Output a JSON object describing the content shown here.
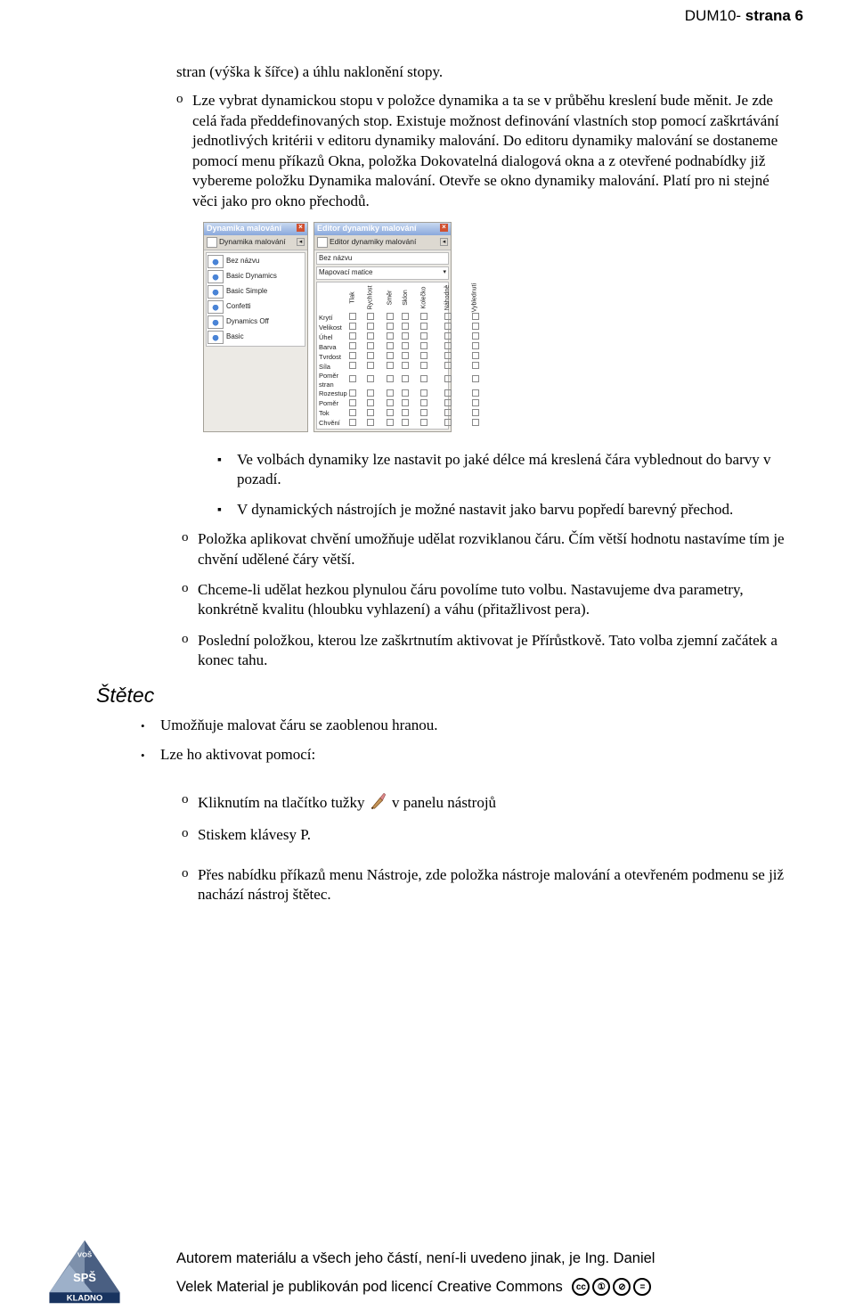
{
  "header": {
    "prefix": "DUM10- ",
    "bold": "strana 6"
  },
  "text": {
    "p0": "stran (výška k šířce) a úhlu naklonění stopy.",
    "o_marker": "o",
    "o1": "Lze vybrat dynamickou stopu v položce dynamika a ta se v průběhu kreslení bude měnit. Je zde celá řada předdefinovaných stop. Existuje možnost definování vlastních stop pomocí zaškrtávání jednotlivých kritérii v editoru  dynamiky malování. Do editoru dynamiky malování se dostaneme pomocí menu příkazů Okna, položka Dokovatelná dialogová okna a z otevřené podnabídky již vybereme položku Dynamika malování. Otevře se okno dynamiky malování. Platí pro ni stejné věci jako pro okno přechodů.",
    "d1": "Ve volbách dynamiky lze nastavit po jaké délce má kreslená čára vyblednout do barvy v pozadí.",
    "d2": " V dynamických nástrojích je možné nastavit jako barvu popředí barevný přechod.",
    "o2": "Položka aplikovat chvění umožňuje udělat rozviklanou čáru. Čím větší hodnotu nastavíme tím je chvění udělené čáry větší.",
    "o3": "Chceme-li udělat hezkou plynulou čáru povolíme tuto volbu. Nastavujeme dva parametry, konkrétně kvalitu (hloubku vyhlazení) a váhu (přitažlivost pera).",
    "o4": "Poslední položkou, kterou lze zaškrtnutím aktivovat je Přírůstkově. Tato volba zjemní začátek a konec tahu.",
    "heading": "Štětec",
    "b1": "Umožňuje malovat čáru se zaoblenou hranou.",
    "b2": "Lze ho aktivovat pomocí:",
    "o5a": " Kliknutím na tlačítko tužky ",
    "o5b": " v panelu nástrojů",
    "o6": "Stiskem klávesy P.",
    "o7": "Přes nabídku příkazů menu Nástroje, zde položka nástroje malování a otevřeném podmenu se již nachází nástroj štětec."
  },
  "panel1": {
    "title": "Dynamika malování",
    "tab": "Dynamika malování",
    "items": [
      "Bez názvu",
      "Basic Dynamics",
      "Basic Simple",
      "Confetti",
      "Dynamics Off",
      "Basic"
    ]
  },
  "panel2": {
    "title": "Editor dynamiky malování",
    "tab": "Editor dynamiky malování",
    "line1": "Bez názvu",
    "line2": "Mapovací matice",
    "cols": [
      "Tlak",
      "Rychlost",
      "Směr",
      "Sklon",
      "Kolečko",
      "Náhodně",
      "Vyblednutí"
    ],
    "rows": [
      "Krytí",
      "Velikost",
      "Úhel",
      "Barva",
      "Tvrdost",
      "Síla",
      "Poměr stran",
      "Rozestup",
      "Poměr",
      "Tok",
      "Chvění"
    ]
  },
  "footer": {
    "l1": "Autorem materiálu a všech jeho částí, není-li uvedeno jinak, je Ing. Daniel",
    "l2": "Velek Material je publikován pod licencí Creative Commons"
  },
  "logo": {
    "top": "VOŠ",
    "mid": "SPŠ",
    "bot": "KLADNO"
  },
  "cc": {
    "b1": "cc",
    "b2": "①",
    "b3": "⊘",
    "b4": "="
  },
  "dot_marker": "▪",
  "bullet_marker": "•"
}
